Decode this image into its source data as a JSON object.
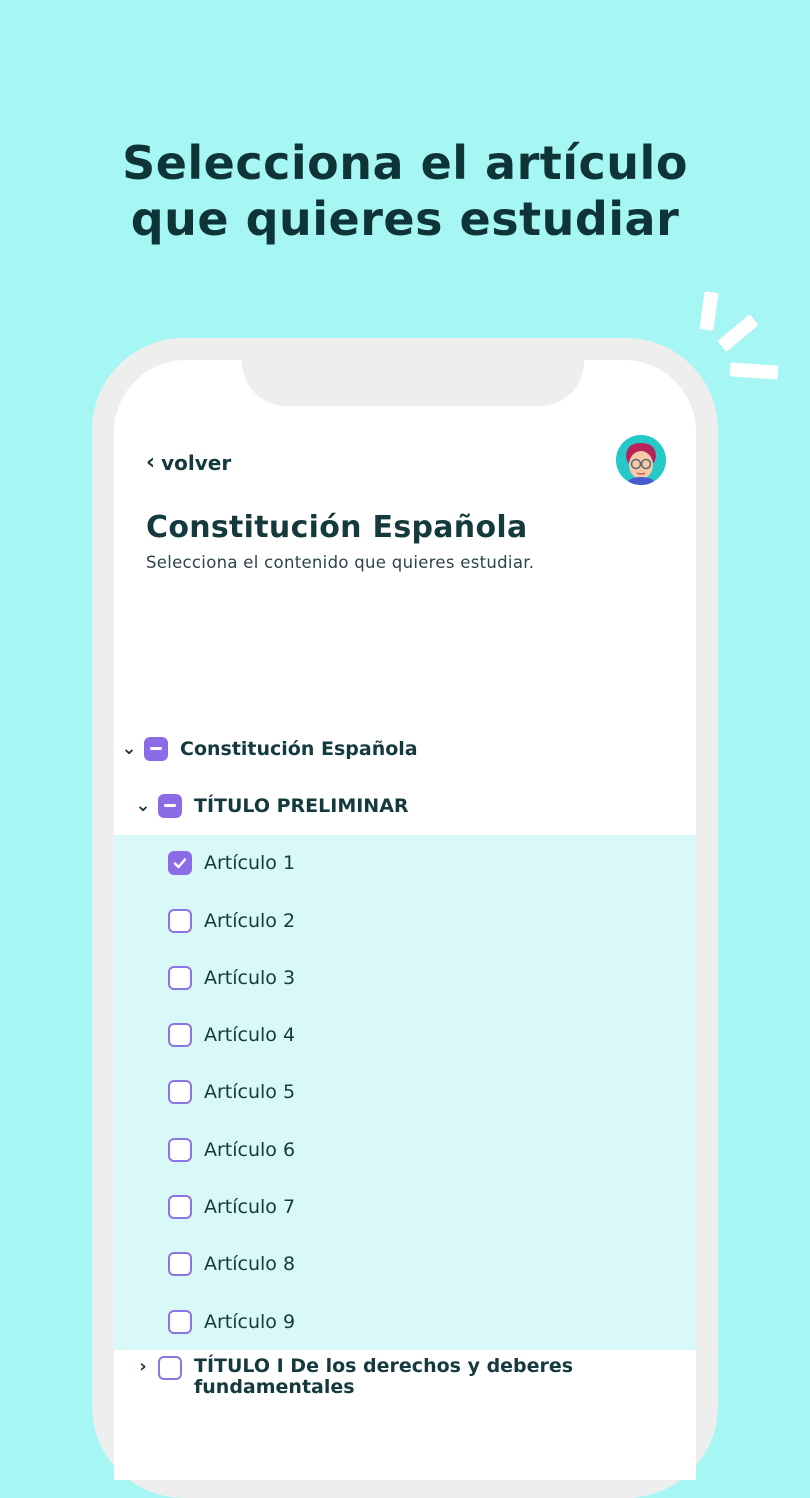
{
  "headline": {
    "line1": "Selecciona el artículo",
    "line2": "que quieres estudiar"
  },
  "colors": {
    "background": "#A6F6F3",
    "accent": "#8B6CE6",
    "text": "#153A3D",
    "highlight": "#D8F9F8"
  },
  "screen": {
    "back_label": "volver",
    "title": "Constitución Española",
    "subtitle": "Selecciona el contenido que quieres estudiar.",
    "tree": {
      "root": {
        "label": "Constitución Española",
        "state": "partial",
        "expanded": true
      },
      "title_preliminar": {
        "label": "TÍTULO PRELIMINAR",
        "state": "partial",
        "expanded": true
      },
      "articles": [
        {
          "label": "Artículo 1",
          "checked": true
        },
        {
          "label": "Artículo 2",
          "checked": false
        },
        {
          "label": "Artículo 3",
          "checked": false
        },
        {
          "label": "Artículo 4",
          "checked": false
        },
        {
          "label": "Artículo 5",
          "checked": false
        },
        {
          "label": "Artículo 6",
          "checked": false
        },
        {
          "label": "Artículo 7",
          "checked": false
        },
        {
          "label": "Artículo 8",
          "checked": false
        },
        {
          "label": "Artículo 9",
          "checked": false
        }
      ],
      "title_1": {
        "label": "TÍTULO I De los derechos y deberes fundamentales",
        "state": "unchecked",
        "expanded": false
      }
    }
  }
}
